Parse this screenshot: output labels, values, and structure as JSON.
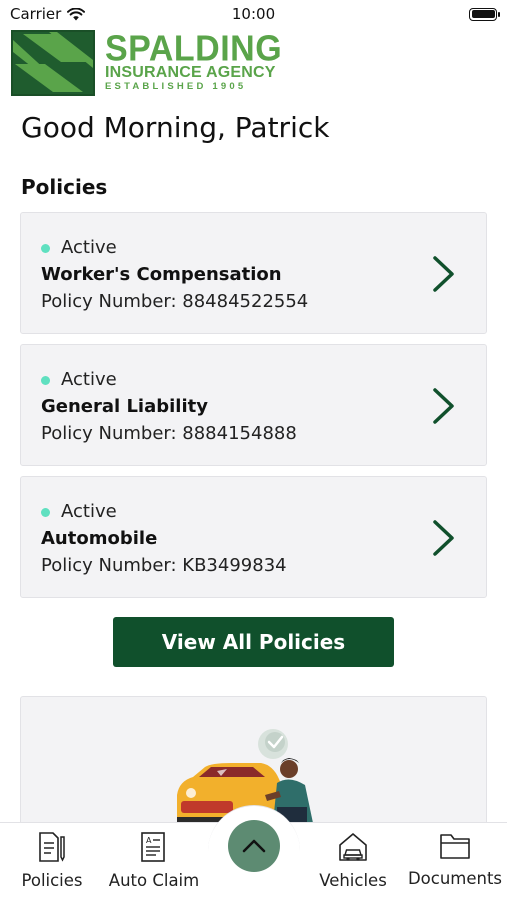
{
  "status_bar": {
    "carrier": "Carrier",
    "time": "10:00",
    "battery_level": 1.0
  },
  "logo": {
    "name": "SPALDING",
    "subtitle": "INSURANCE AGENCY",
    "established": "ESTABLISHED 1905"
  },
  "greeting": "Good Morning, Patrick",
  "policies_section": {
    "title": "Policies",
    "items": [
      {
        "status": "Active",
        "name": "Worker's Compensation",
        "number": "Policy Number: 88484522554"
      },
      {
        "status": "Active",
        "name": "General Liability",
        "number": "Policy Number: 8884154888"
      },
      {
        "status": "Active",
        "name": "Automobile",
        "number": "Policy Number: KB3499834"
      }
    ],
    "view_all_label": "View All Policies"
  },
  "tabs": [
    {
      "label": "Policies",
      "icon": "policies-document-icon"
    },
    {
      "label": "Auto Claim",
      "icon": "auto-claim-form-icon"
    },
    {
      "label": "Vehicles",
      "icon": "vehicles-garage-icon"
    },
    {
      "label": "Documents",
      "icon": "documents-folder-icon"
    }
  ],
  "fab_icon": "chevron-up-icon",
  "colors": {
    "brand_green": "#10502c",
    "logo_green": "#5aa44a",
    "active_dot": "#5fe0c0",
    "card_bg": "#f3f3f5",
    "fab": "#5d8b72"
  }
}
